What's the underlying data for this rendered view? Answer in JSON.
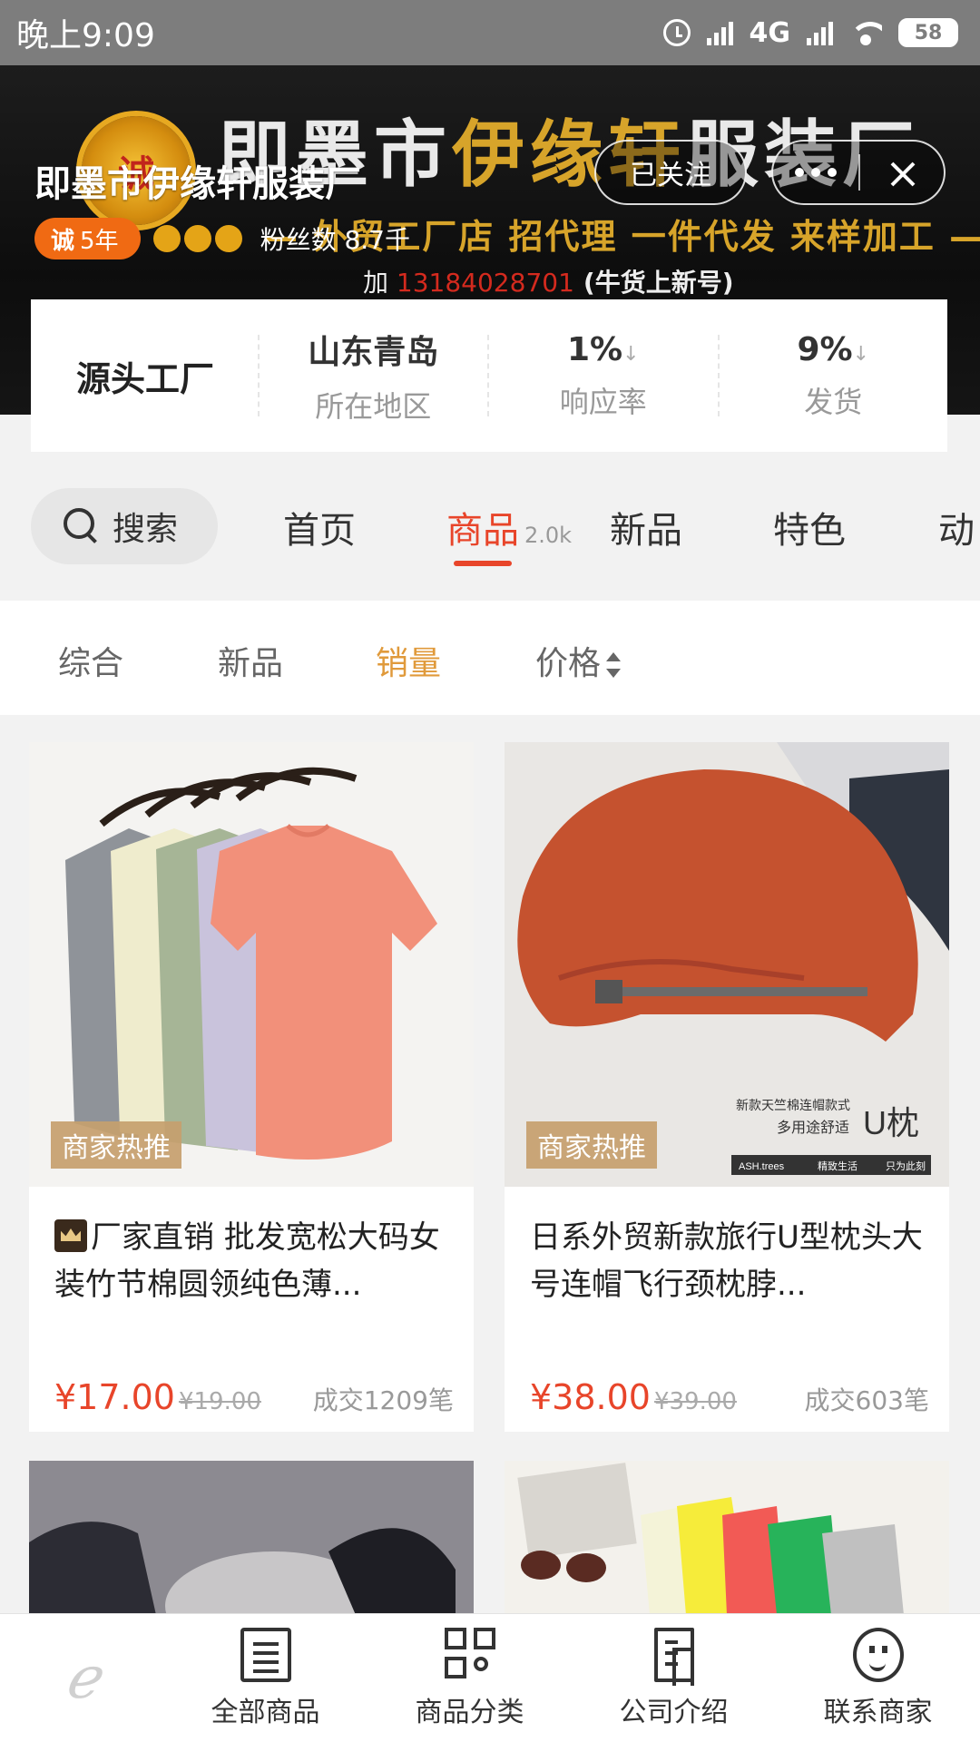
{
  "status_bar": {
    "time": "晚上9:09",
    "network": "4G",
    "battery": "58"
  },
  "hero": {
    "banner_title_a": "即墨市",
    "banner_title_b": "伊缘轩",
    "banner_title_c": "服装厂",
    "banner_subtitle": "— 外贸工厂店 招代理 一件代发 来样加工 —",
    "banner_phone_prefix": "加",
    "banner_phone": "13184028701",
    "banner_phone_note": "(牛货上新号)",
    "shop_name": "即墨市伊缘轩服装厂",
    "cheng_badge": "诚",
    "cheng_years": "5年",
    "fans_label": "粉丝数 8.7千",
    "follow_label": "已关注"
  },
  "info_card": {
    "title": "源头工厂",
    "stats": [
      {
        "value": "山东青岛",
        "label": "所在地区"
      },
      {
        "value": "1%",
        "label": "响应率"
      },
      {
        "value": "9%",
        "label": "发货"
      }
    ]
  },
  "tabs": {
    "search_label": "搜索",
    "items": [
      {
        "label": "首页",
        "count": ""
      },
      {
        "label": "商品",
        "count": "2.0k"
      },
      {
        "label": "新品",
        "count": ""
      },
      {
        "label": "特色",
        "count": ""
      },
      {
        "label": "动",
        "count": ""
      }
    ]
  },
  "sort_bar": {
    "items": [
      "综合",
      "新品",
      "销量",
      "价格"
    ],
    "active": "销量"
  },
  "products": [
    {
      "tag": "商家热推",
      "title": "厂家直销 批发宽松大码女装竹节棉圆领纯色薄...",
      "price": "¥17.00",
      "old_price": "¥19.00",
      "sold": "成交1209笔",
      "image_text": ""
    },
    {
      "tag": "商家热推",
      "title": "日系外贸新款旅行U型枕头大号连帽飞行颈枕脖...",
      "price": "¥38.00",
      "old_price": "¥39.00",
      "sold": "成交603笔",
      "image_text_a": "新款天竺棉连帽款式",
      "image_text_b": "多用途舒适",
      "image_text_c": "U枕",
      "image_text_d": "ASH.trees",
      "image_text_e": "精致生活",
      "image_text_f": "只为此刻"
    }
  ],
  "bottom_nav": {
    "items": [
      "全部商品",
      "商品分类",
      "公司介绍",
      "联系商家"
    ]
  },
  "colors": {
    "accent": "#e8452a",
    "sort_active": "#e09a3b",
    "badge_orange": "#f06a13",
    "tag_bg": "#c6a06e"
  }
}
